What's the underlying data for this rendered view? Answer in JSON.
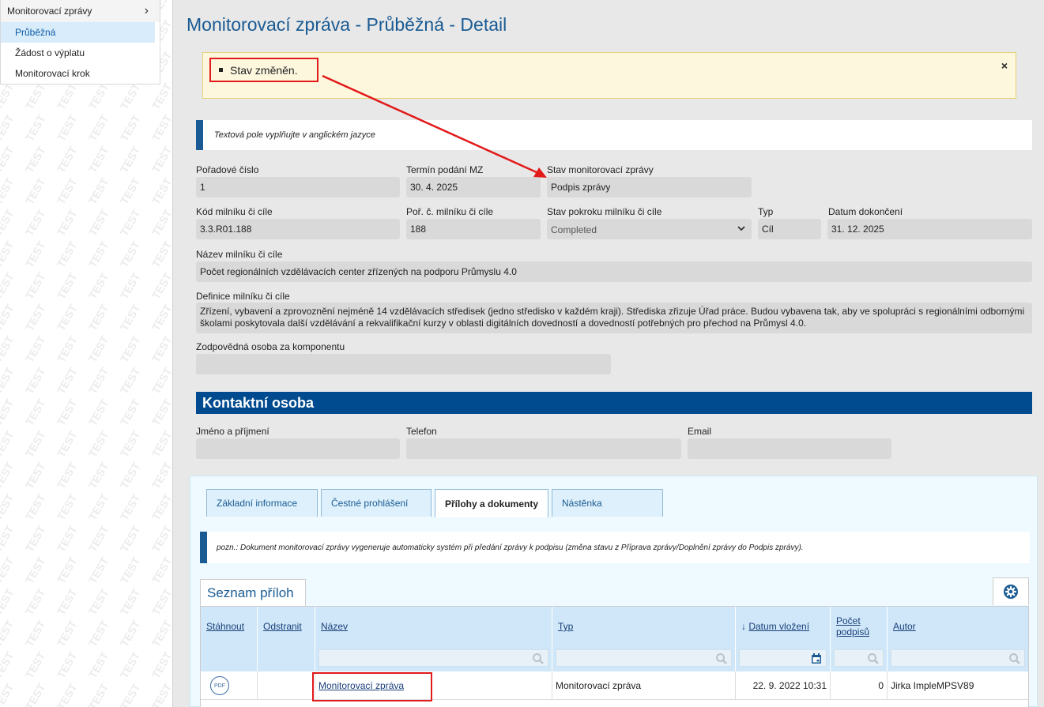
{
  "sidebar": {
    "header": "Monitorovací zprávy",
    "items": [
      "Průběžná",
      "Žádost o výplatu",
      "Monitorovací krok"
    ],
    "watermark": "TEST"
  },
  "page": {
    "title": "Monitorovací zpráva - Průběžná - Detail"
  },
  "alert": {
    "message": "Stav změněn.",
    "close": "×"
  },
  "note": "Textová pole vyplňujte v anglickém jazyce",
  "fields": {
    "poradove_cislo": {
      "label": "Pořadové číslo",
      "value": "1"
    },
    "termin": {
      "label": "Termín podání MZ",
      "value": "30. 4. 2025"
    },
    "stav_mz": {
      "label": "Stav monitorovací zprávy",
      "value": "Podpis zprávy"
    },
    "kod": {
      "label": "Kód milníku či cíle",
      "value": "3.3.R01.188"
    },
    "por_c": {
      "label": "Poř. č. milníku či cíle",
      "value": "188"
    },
    "stav_pokroku": {
      "label": "Stav pokroku milníku či cíle",
      "value": "Completed"
    },
    "typ": {
      "label": "Typ",
      "value": "Cíl"
    },
    "datum_dokonceni": {
      "label": "Datum dokončení",
      "value": "31. 12. 2025"
    },
    "nazev": {
      "label": "Název milníku či cíle",
      "value": "Počet regionálních vzdělávacích center zřízených na podporu Průmyslu 4.0"
    },
    "definice": {
      "label": "Definice milníku či cíle",
      "value": "Zřízení, vybavení a zprovoznění nejméně 14 vzdělávacích středisek (jedno středisko v každém kraji). Střediska zřizuje Úřad práce. Budou vybavena tak, aby ve spolupráci s regionálními odbornými školami poskytovala další vzdělávání a rekvalifikační kurzy v oblasti digitálních dovedností a dovedností potřebných pro přechod na Průmysl 4.0."
    },
    "zodpovedna": {
      "label": "Zodpovědná osoba za komponentu",
      "value": ""
    }
  },
  "contact": {
    "heading": "Kontaktní osoba",
    "jmeno": {
      "label": "Jméno a příjmení",
      "value": ""
    },
    "telefon": {
      "label": "Telefon",
      "value": ""
    },
    "email": {
      "label": "Email",
      "value": ""
    }
  },
  "tabs": [
    "Základní informace",
    "Čestné prohlášení",
    "Přílohy a dokumenty",
    "Nástěnka"
  ],
  "active_tab": "Přílohy a dokumenty",
  "pozn": "pozn.: Dokument monitorovací zprávy vygeneruje automaticky systém při předání zprávy k podpisu (změna stavu z Příprava zprávy/Doplnění zprávy do Podpis zprávy).",
  "attachments": {
    "title": "Seznam příloh",
    "columns": [
      "Stáhnout",
      "Odstranit",
      "Název",
      "Typ",
      "Datum vložení",
      "Počet podpisů",
      "Autor"
    ],
    "rows": [
      {
        "stahnout": "PDF",
        "odstranit": "",
        "nazev": "Monitorovací zpráva",
        "typ": "Monitorovací zpráva",
        "datum": "22. 9. 2022 10:31",
        "pocet": "0",
        "autor": "Jirka ImpleMPSV89"
      }
    ]
  },
  "colors": {
    "brand": "#1a5b93",
    "header_bar": "#004a8f",
    "highlight": "#e21a1a",
    "alert_bg": "#fdf7de"
  }
}
